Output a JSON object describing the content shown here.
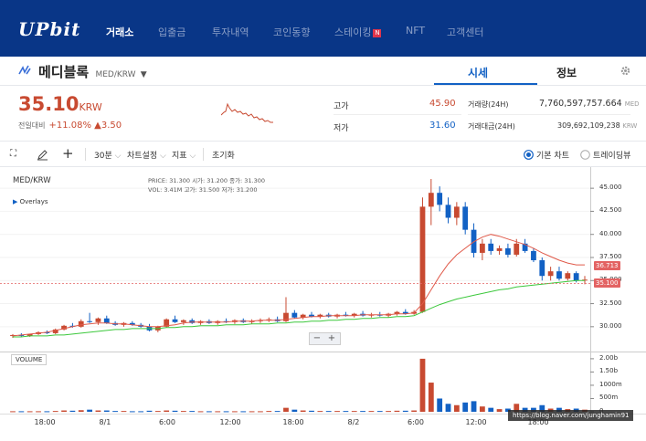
{
  "header": {
    "logo": "UPbit",
    "nav": [
      "거래소",
      "입출금",
      "투자내역",
      "코인동향",
      "스테이킹",
      "NFT",
      "고객센터"
    ],
    "staking_badge": "N"
  },
  "coin": {
    "name": "메디블록",
    "pair": "MED/KRW",
    "tabs": [
      "시세",
      "정보"
    ],
    "price": "35.10",
    "currency": "KRW",
    "change_label": "전일대비",
    "change_pct": "+11.08%",
    "change_abs": "▲3.50"
  },
  "stats": {
    "high_label": "고가",
    "high": "45.90",
    "low_label": "저가",
    "low": "31.60",
    "vol_label": "거래량(24H)",
    "vol": "7,760,597,757.664",
    "vol_unit": "MED",
    "amt_label": "거래대금(24H)",
    "amt": "309,692,109,238",
    "amt_unit": "KRW"
  },
  "toolbar": {
    "interval": "30분",
    "settings": "차트설정",
    "indicators": "지표",
    "reset": "초기화",
    "opt_basic": "기본 차트",
    "opt_tv": "트레이딩뷰"
  },
  "chart": {
    "symbol": "MED/KRW",
    "overlays": "Overlays",
    "ohlc_line1": "PRICE: 31.300   시가: 31.200   종가: 31.300",
    "ohlc_line2": "VOL:   3.41M   고가: 31.500   저가: 31.200",
    "volume_label": "VOLUME",
    "zoom_minus": "−",
    "zoom_plus": "+",
    "price_tag": "35.100",
    "ma_tag": "36.713",
    "watermark": "https://blog.naver.com/junghamin91"
  },
  "colors": {
    "up": "#c84a31",
    "down": "#1261c4",
    "ma_short": "#e05a4a",
    "ma_long": "#3cc83c",
    "nav_bg": "#093687"
  },
  "chart_data": {
    "type": "candlestick",
    "y_ticks": [
      "45.000",
      "42.500",
      "40.000",
      "37.500",
      "35.000",
      "32.500",
      "30.000"
    ],
    "y_tick_values": [
      45,
      42.5,
      40,
      37.5,
      35,
      32.5,
      30
    ],
    "vol_ticks": [
      "2.00b",
      "1.50b",
      "1000m",
      "500m",
      "0"
    ],
    "vol_tick_values": [
      2.0,
      1.5,
      1.0,
      0.5,
      0
    ],
    "x_labels": [
      "18:00",
      "8/1",
      "6:00",
      "12:00",
      "18:00",
      "8/2",
      "6:00",
      "12:00",
      "18:00"
    ],
    "ylim": [
      28.5,
      46.3
    ],
    "vol_ylim": [
      0,
      2.1
    ],
    "candles": [
      [
        29.0,
        29.2,
        28.8,
        29.1,
        0.02
      ],
      [
        29.1,
        29.3,
        28.9,
        29.0,
        0.02
      ],
      [
        29.0,
        29.2,
        28.9,
        29.2,
        0.02
      ],
      [
        29.2,
        29.5,
        29.1,
        29.4,
        0.02
      ],
      [
        29.4,
        29.6,
        29.2,
        29.3,
        0.02
      ],
      [
        29.3,
        29.8,
        29.2,
        29.7,
        0.03
      ],
      [
        29.7,
        30.2,
        29.6,
        30.1,
        0.05
      ],
      [
        30.1,
        30.4,
        29.9,
        30.0,
        0.04
      ],
      [
        30.0,
        30.8,
        29.9,
        30.6,
        0.06
      ],
      [
        30.6,
        31.5,
        30.4,
        30.5,
        0.08
      ],
      [
        30.5,
        31.0,
        30.2,
        30.9,
        0.05
      ],
      [
        30.9,
        31.2,
        30.3,
        30.4,
        0.05
      ],
      [
        30.4,
        30.6,
        30.1,
        30.2,
        0.03
      ],
      [
        30.2,
        30.5,
        30.0,
        30.4,
        0.03
      ],
      [
        30.4,
        30.6,
        30.1,
        30.2,
        0.02
      ],
      [
        30.2,
        30.4,
        29.9,
        30.0,
        0.02
      ],
      [
        30.0,
        30.3,
        29.5,
        29.6,
        0.04
      ],
      [
        29.6,
        30.1,
        29.4,
        30.0,
        0.03
      ],
      [
        30.0,
        30.9,
        29.9,
        30.8,
        0.05
      ],
      [
        30.8,
        31.2,
        30.4,
        30.5,
        0.04
      ],
      [
        30.5,
        30.8,
        30.2,
        30.7,
        0.03
      ],
      [
        30.7,
        30.9,
        30.3,
        30.4,
        0.03
      ],
      [
        30.4,
        30.7,
        30.2,
        30.6,
        0.02
      ],
      [
        30.6,
        30.8,
        30.3,
        30.4,
        0.02
      ],
      [
        30.4,
        30.7,
        30.2,
        30.6,
        0.02
      ],
      [
        30.6,
        30.9,
        30.4,
        30.5,
        0.02
      ],
      [
        30.5,
        30.8,
        30.3,
        30.7,
        0.02
      ],
      [
        30.7,
        30.9,
        30.4,
        30.5,
        0.02
      ],
      [
        30.5,
        30.8,
        30.3,
        30.6,
        0.02
      ],
      [
        30.6,
        30.9,
        30.4,
        30.7,
        0.02
      ],
      [
        30.7,
        31.0,
        30.5,
        30.8,
        0.03
      ],
      [
        30.8,
        31.1,
        30.5,
        30.6,
        0.03
      ],
      [
        30.6,
        33.2,
        30.5,
        31.5,
        0.15
      ],
      [
        31.5,
        31.8,
        30.9,
        31.0,
        0.08
      ],
      [
        31.0,
        31.4,
        30.8,
        31.3,
        0.05
      ],
      [
        31.3,
        31.6,
        31.0,
        31.1,
        0.04
      ],
      [
        31.1,
        31.4,
        30.9,
        31.3,
        0.03
      ],
      [
        31.3,
        31.5,
        31.0,
        31.1,
        0.03
      ],
      [
        31.1,
        31.4,
        30.9,
        31.3,
        0.03
      ],
      [
        31.3,
        31.6,
        31.1,
        31.2,
        0.03
      ],
      [
        31.2,
        31.5,
        31.0,
        31.4,
        0.03
      ],
      [
        31.4,
        31.7,
        31.1,
        31.2,
        0.03
      ],
      [
        31.2,
        31.5,
        31.0,
        31.3,
        0.03
      ],
      [
        31.3,
        31.6,
        31.1,
        31.2,
        0.03
      ],
      [
        31.2,
        31.5,
        31.0,
        31.4,
        0.03
      ],
      [
        31.4,
        31.7,
        31.2,
        31.6,
        0.04
      ],
      [
        31.6,
        31.9,
        31.3,
        31.4,
        0.04
      ],
      [
        31.4,
        31.8,
        31.3,
        31.6,
        0.05
      ],
      [
        31.6,
        44.0,
        31.5,
        43.0,
        2.0
      ],
      [
        43.0,
        46.0,
        41.0,
        44.5,
        1.1
      ],
      [
        44.5,
        45.2,
        42.5,
        43.2,
        0.5
      ],
      [
        43.2,
        44.0,
        41.2,
        41.8,
        0.3
      ],
      [
        41.8,
        43.5,
        41.0,
        43.0,
        0.25
      ],
      [
        43.0,
        43.5,
        40.0,
        40.5,
        0.35
      ],
      [
        40.5,
        41.2,
        37.5,
        38.0,
        0.4
      ],
      [
        38.0,
        39.5,
        37.2,
        39.0,
        0.2
      ],
      [
        39.0,
        39.5,
        37.8,
        38.2,
        0.15
      ],
      [
        38.2,
        38.8,
        37.8,
        38.5,
        0.1
      ],
      [
        38.5,
        39.0,
        37.5,
        37.8,
        0.12
      ],
      [
        37.8,
        39.5,
        37.6,
        39.0,
        0.3
      ],
      [
        39.0,
        39.5,
        38.0,
        38.2,
        0.15
      ],
      [
        38.2,
        38.5,
        37.0,
        37.2,
        0.15
      ],
      [
        37.2,
        37.5,
        35.0,
        35.5,
        0.25
      ],
      [
        35.5,
        36.5,
        35.0,
        36.0,
        0.12
      ],
      [
        36.0,
        36.5,
        35.0,
        35.2,
        0.15
      ],
      [
        35.2,
        36.0,
        35.0,
        35.8,
        0.1
      ],
      [
        35.8,
        36.0,
        34.8,
        35.0,
        0.12
      ],
      [
        35.0,
        35.5,
        34.6,
        35.1,
        0.08
      ]
    ],
    "ma_short": [
      29.0,
      29.1,
      29.2,
      29.3,
      29.4,
      29.6,
      29.8,
      30.0,
      30.2,
      30.3,
      30.4,
      30.4,
      30.3,
      30.3,
      30.2,
      30.1,
      30.0,
      30.0,
      30.1,
      30.2,
      30.4,
      30.5,
      30.5,
      30.5,
      30.5,
      30.5,
      30.6,
      30.6,
      30.6,
      30.7,
      30.7,
      30.7,
      30.8,
      30.9,
      31.0,
      31.1,
      31.1,
      31.2,
      31.2,
      31.2,
      31.2,
      31.3,
      31.3,
      31.3,
      31.3,
      31.4,
      31.4,
      31.5,
      32.5,
      34.0,
      35.5,
      36.8,
      37.8,
      38.5,
      39.2,
      39.7,
      40.0,
      39.8,
      39.5,
      39.2,
      38.9,
      38.5,
      38.0,
      37.6,
      37.2,
      36.9,
      36.7,
      36.7
    ],
    "ma_long": [
      28.9,
      28.9,
      29.0,
      29.0,
      29.0,
      29.1,
      29.1,
      29.2,
      29.3,
      29.4,
      29.5,
      29.6,
      29.7,
      29.7,
      29.8,
      29.8,
      29.8,
      29.8,
      29.9,
      29.9,
      30.0,
      30.0,
      30.1,
      30.1,
      30.1,
      30.2,
      30.2,
      30.2,
      30.3,
      30.3,
      30.3,
      30.4,
      30.4,
      30.5,
      30.5,
      30.6,
      30.6,
      30.7,
      30.7,
      30.8,
      30.8,
      30.9,
      30.9,
      31.0,
      31.0,
      31.1,
      31.1,
      31.2,
      31.6,
      32.0,
      32.4,
      32.7,
      33.0,
      33.2,
      33.4,
      33.6,
      33.8,
      34.0,
      34.1,
      34.3,
      34.4,
      34.5,
      34.6,
      34.7,
      34.8,
      34.9,
      35.0,
      35.0
    ]
  }
}
